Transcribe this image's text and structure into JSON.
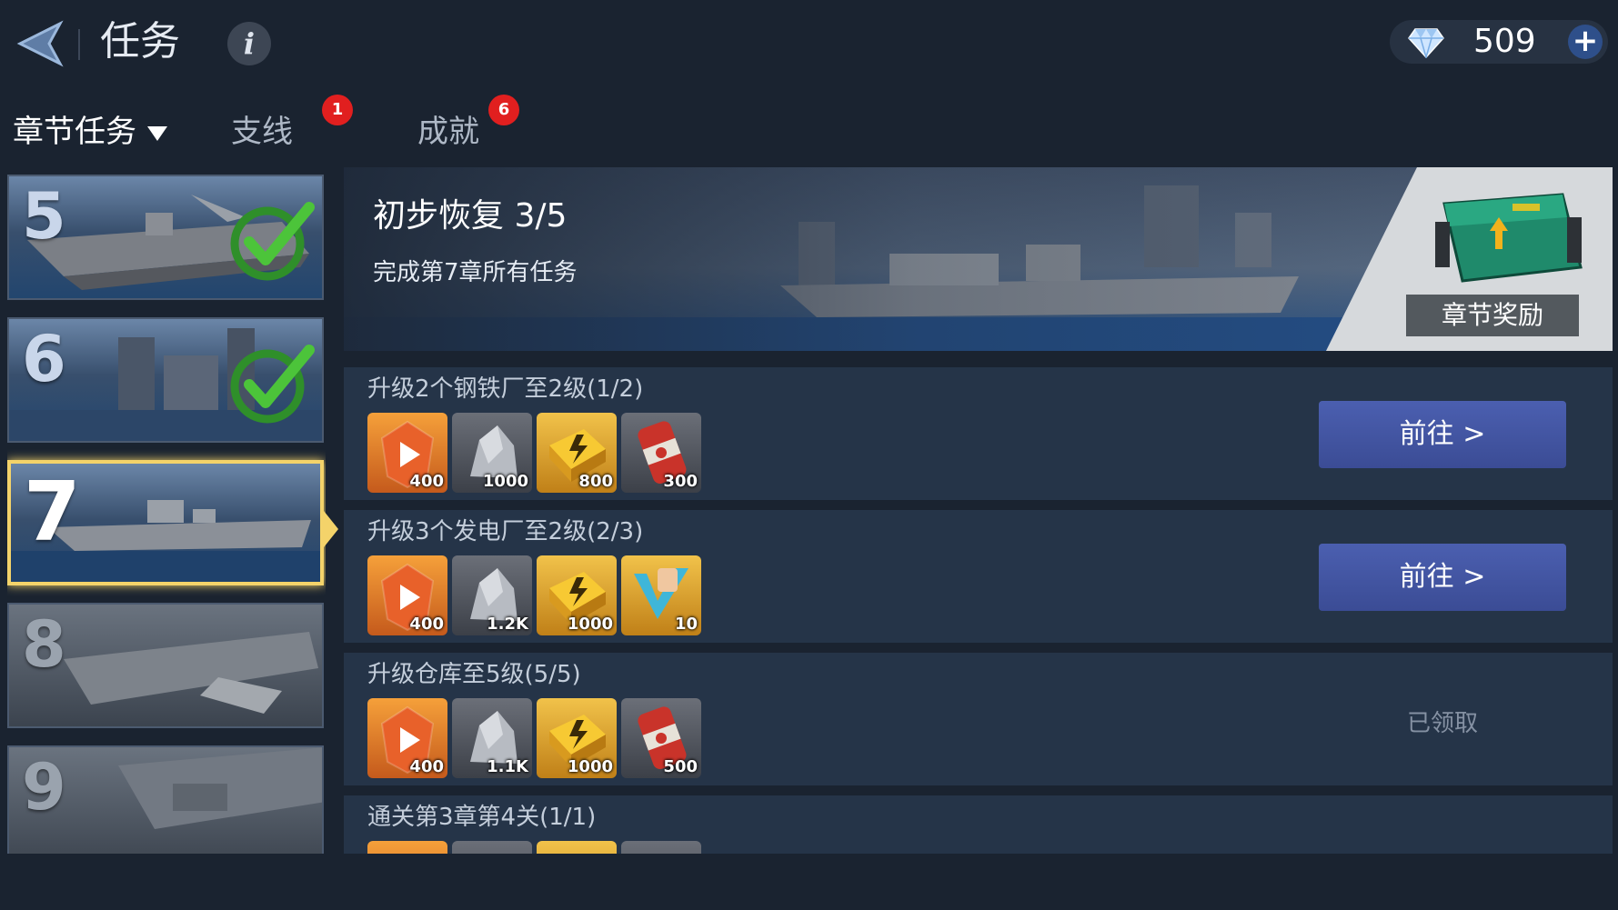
{
  "header": {
    "title": "任务",
    "info_symbol": "i",
    "currency_value": "509",
    "add_symbol": "+",
    "currency_icon": "diamond-gem-icon"
  },
  "tabs": [
    {
      "label": "章节任务",
      "active": true,
      "badge": ""
    },
    {
      "label": "支线",
      "active": false,
      "badge": "1"
    },
    {
      "label": "成就",
      "active": false,
      "badge": "6"
    }
  ],
  "chapters": [
    {
      "number": "5",
      "status": "completed"
    },
    {
      "number": "6",
      "status": "completed"
    },
    {
      "number": "7",
      "status": "selected"
    },
    {
      "number": "8",
      "status": "locked"
    },
    {
      "number": "9",
      "status": "locked"
    }
  ],
  "banner": {
    "name": "初步恢复 3/5",
    "description": "完成第7章所有任务",
    "reward_label": "章节奖励"
  },
  "tasks": [
    {
      "name": "升级2个钢铁厂至2级(1/2)",
      "action": "前往 >",
      "state": "go",
      "rewards": [
        {
          "icon": "exp-badge-icon",
          "qty": "400"
        },
        {
          "icon": "stone-icon",
          "qty": "1000"
        },
        {
          "icon": "energy-pack-icon",
          "qty": "800"
        },
        {
          "icon": "oil-barrel-icon",
          "qty": "300"
        }
      ]
    },
    {
      "name": "升级3个发电厂至2级(2/3)",
      "action": "前往 >",
      "state": "go",
      "rewards": [
        {
          "icon": "exp-badge-icon",
          "qty": "400"
        },
        {
          "icon": "stone-icon",
          "qty": "1.2K"
        },
        {
          "icon": "energy-pack-icon",
          "qty": "1000"
        },
        {
          "icon": "power-fist-icon",
          "qty": "10"
        }
      ]
    },
    {
      "name": "升级仓库至5级(5/5)",
      "action": "已领取",
      "state": "claimed",
      "rewards": [
        {
          "icon": "exp-badge-icon",
          "qty": "400"
        },
        {
          "icon": "stone-icon",
          "qty": "1.1K"
        },
        {
          "icon": "energy-pack-icon",
          "qty": "1000"
        },
        {
          "icon": "oil-barrel-icon",
          "qty": "500"
        }
      ]
    },
    {
      "name": "通关第3章第4关(1/1)",
      "action": "",
      "state": "partial",
      "rewards": [
        {
          "icon": "exp-badge-icon",
          "qty": ""
        },
        {
          "icon": "stone-icon",
          "qty": ""
        },
        {
          "icon": "energy-pack-icon",
          "qty": ""
        },
        {
          "icon": "oil-barrel-icon",
          "qty": ""
        }
      ]
    }
  ],
  "colors": {
    "background": "#1a2330",
    "panel": "#253448",
    "go_button": "#4b5fb0",
    "selected_border": "#f4d36a",
    "badge": "#e11f1f",
    "check": "#4cc43a"
  }
}
